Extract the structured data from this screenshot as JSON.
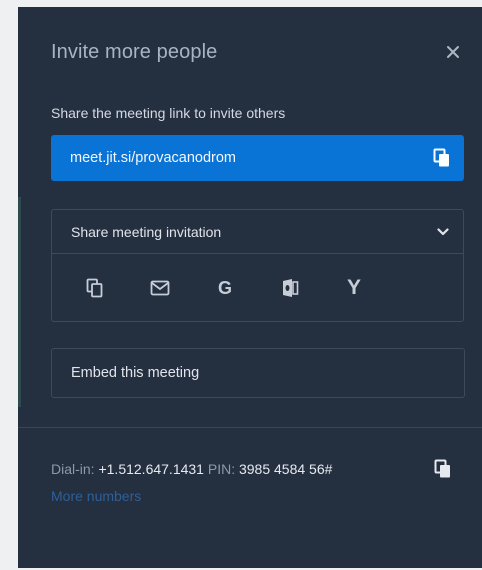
{
  "dialog": {
    "title": "Invite more people",
    "close_icon": "close-icon"
  },
  "share_link": {
    "label": "Share the meeting link to invite others",
    "url": "meet.jit.si/provacanodrom",
    "copy_icon": "copy-icon"
  },
  "share_invitation": {
    "label": "Share meeting invitation",
    "expand_icon": "chevron-down-icon",
    "options": [
      {
        "name": "copy-invitation",
        "icon": "copy-icon"
      },
      {
        "name": "email",
        "icon": "mail-icon"
      },
      {
        "name": "gmail",
        "icon": "google-icon",
        "glyph": "G"
      },
      {
        "name": "outlook",
        "icon": "outlook-icon"
      },
      {
        "name": "yahoo",
        "icon": "yahoo-icon",
        "glyph": "Y"
      }
    ]
  },
  "embed": {
    "label": "Embed this meeting"
  },
  "dial_in": {
    "dial_label": "Dial-in:",
    "phone": "+1.512.647.1431",
    "pin_label": "PIN:",
    "pin": "3985 4584 56#",
    "more_numbers": "More numbers",
    "copy_icon": "copy-icon"
  },
  "colors": {
    "dialog_background": "#242f40",
    "accent": "#0a74d6",
    "border": "#3e4a5c",
    "link_muted": "#2f5f99",
    "page_background": "#eef0f2"
  }
}
